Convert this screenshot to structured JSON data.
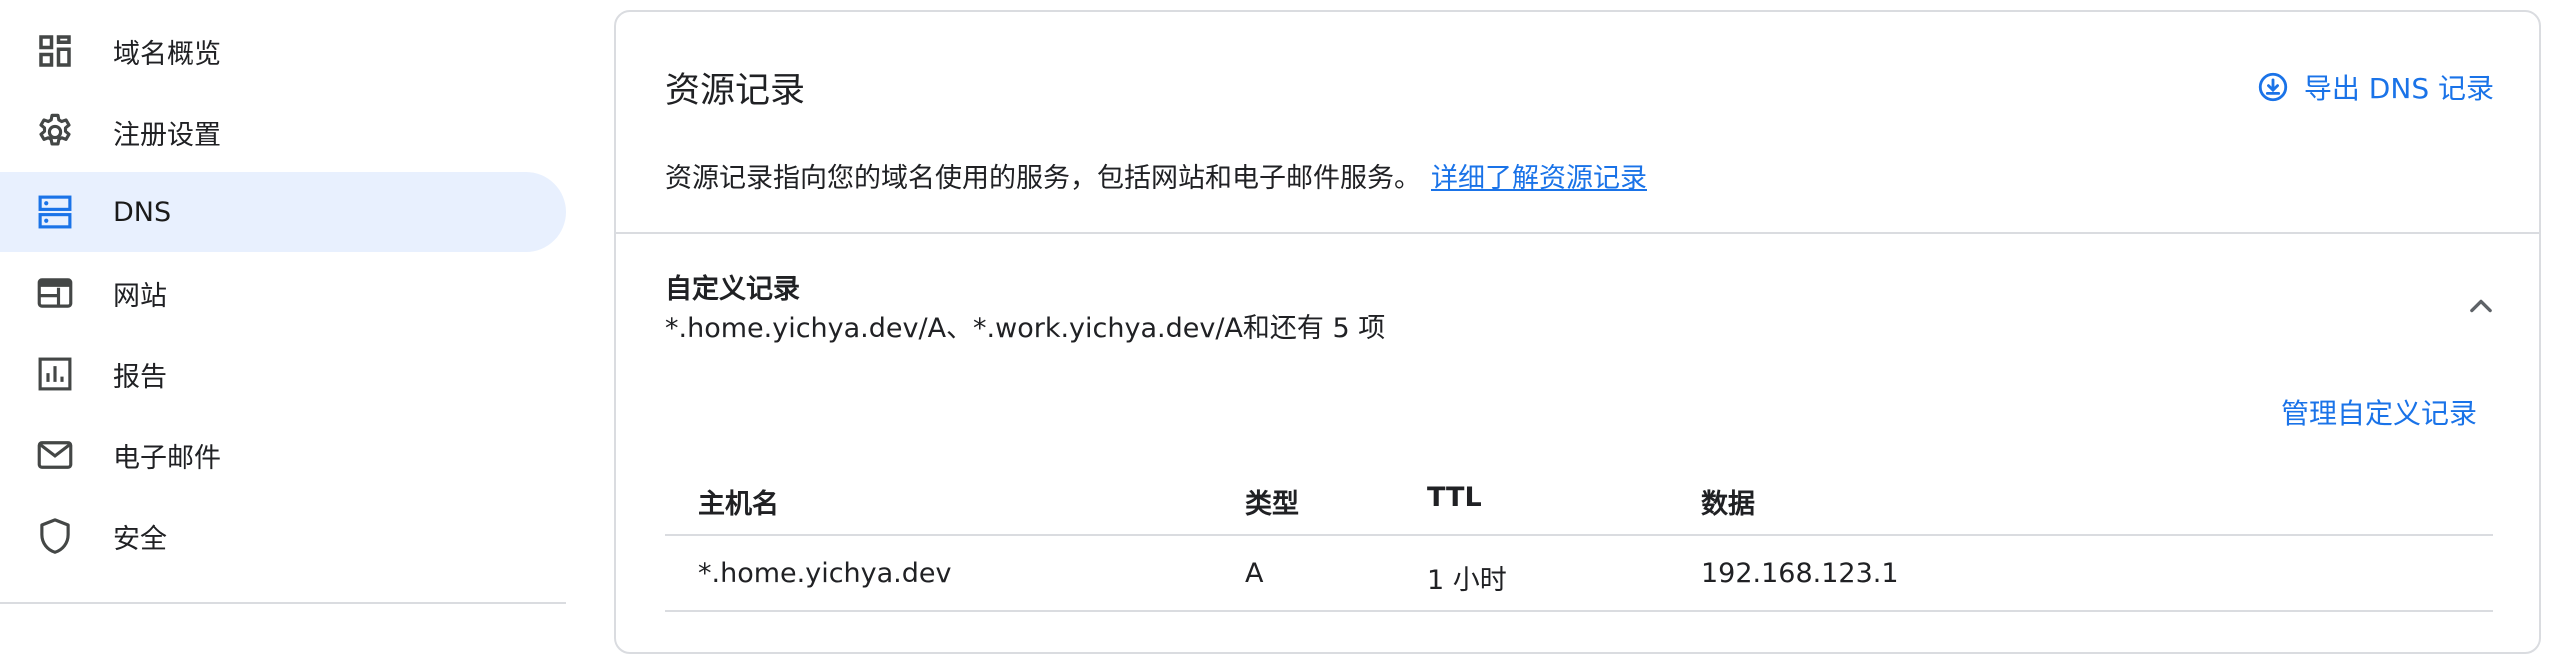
{
  "sidebar": {
    "items": [
      {
        "label": "域名概览",
        "icon": "dashboard-icon",
        "active": false
      },
      {
        "label": "注册设置",
        "icon": "gear-icon",
        "active": false
      },
      {
        "label": "DNS",
        "icon": "dns-icon",
        "active": true
      },
      {
        "label": "网站",
        "icon": "web-icon",
        "active": false
      },
      {
        "label": "报告",
        "icon": "bar-chart-icon",
        "active": false
      },
      {
        "label": "电子邮件",
        "icon": "mail-icon",
        "active": false
      },
      {
        "label": "安全",
        "icon": "shield-icon",
        "active": false
      }
    ]
  },
  "card": {
    "title": "资源记录",
    "export_label": "导出 DNS 记录",
    "description": "资源记录指向您的域名使用的服务，包括网站和电子邮件服务。",
    "learn_more_link": "详细了解资源记录",
    "section": {
      "title": "自定义记录",
      "summary": "*.home.yichya.dev/A、*.work.yichya.dev/A和还有 5 项",
      "manage_link": "管理自定义记录"
    },
    "table": {
      "headers": [
        "主机名",
        "类型",
        "TTL",
        "数据"
      ],
      "rows": [
        [
          "*.home.yichya.dev",
          "A",
          "1 小时",
          "192.168.123.1"
        ]
      ]
    }
  },
  "colors": {
    "accent": "#1a73e8",
    "active_bg": "#e8f0fe",
    "icon": "#444746",
    "divider": "#dadce0"
  }
}
